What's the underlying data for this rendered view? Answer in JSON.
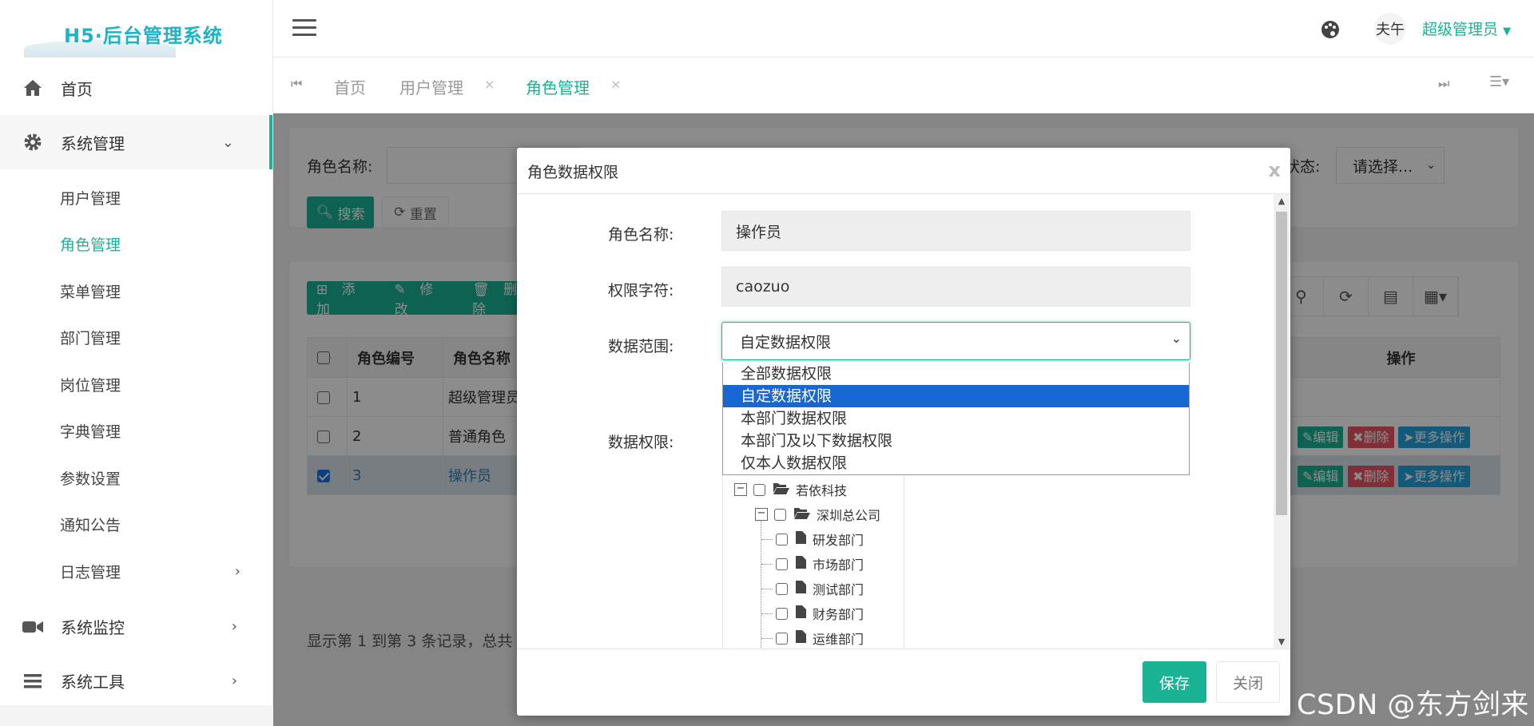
{
  "app": {
    "logo_text": "H5·后台管理系统"
  },
  "sidebar": {
    "home": "首页",
    "system_mgmt": "系统管理",
    "sub_items": [
      "用户管理",
      "角色管理",
      "菜单管理",
      "部门管理",
      "岗位管理",
      "字典管理",
      "参数设置",
      "通知公告",
      "日志管理"
    ],
    "system_monitor": "系统监控",
    "system_tools": "系统工具"
  },
  "topbar": {
    "user_name": "超级管理员",
    "avatar_text": "夫午"
  },
  "tabs": {
    "items": [
      "首页",
      "用户管理",
      "角色管理"
    ],
    "close": "×"
  },
  "search": {
    "role_name_label": "角色名称:",
    "status_label": "状态:",
    "status_value": "请选择...",
    "search_btn": "搜索",
    "reset_btn": "重置"
  },
  "toolbar": {
    "add": "添加",
    "edit": "修改",
    "delete": "删除"
  },
  "table": {
    "headers": [
      "角色编号",
      "角色名称",
      "操作"
    ],
    "rows": [
      {
        "id": "1",
        "name": "超级管理员"
      },
      {
        "id": "2",
        "name": "普通角色"
      },
      {
        "id": "3",
        "name": "操作员"
      }
    ],
    "actions": {
      "edit": "编辑",
      "delete": "删除",
      "more": "更多操作"
    },
    "page_info": "显示第 1 到第 3 条记录，总共"
  },
  "modal": {
    "title": "角色数据权限",
    "close_x": "x",
    "labels": {
      "role_name": "角色名称:",
      "perm_key": "权限字符:",
      "data_scope": "数据范围:",
      "data_perm": "数据权限:"
    },
    "role_name": "操作员",
    "perm_key": "caozuo",
    "data_scope_value": "自定数据权限",
    "scope_options": [
      "全部数据权限",
      "自定数据权限",
      "本部门数据权限",
      "本部门及以下数据权限",
      "仅本人数据权限"
    ],
    "selected_option_index": 1,
    "tree": {
      "root": "若依科技",
      "branch": "深圳总公司",
      "leaves": [
        "研发部门",
        "市场部门",
        "测试部门",
        "财务部门",
        "运维部门"
      ]
    },
    "save_btn": "保存",
    "close_btn": "关闭"
  },
  "watermark": "CSDN @东方剑来",
  "colors": {
    "accent": "#1ab394",
    "danger": "#ed5565",
    "info": "#23a3dc",
    "selected_option": "#1967d2"
  }
}
